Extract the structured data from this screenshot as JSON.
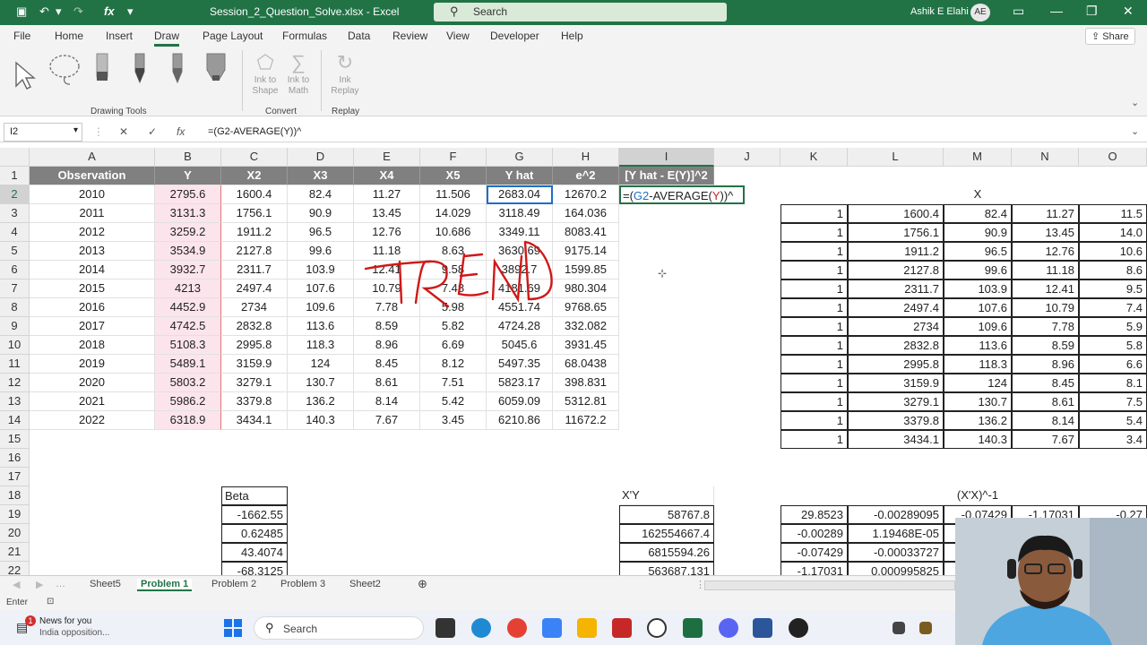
{
  "titlebar": {
    "title": "Session_2_Question_Solve.xlsx - Excel",
    "search_placeholder": "Search",
    "user_name": "Ashik E Elahi",
    "user_initials": "AE"
  },
  "menu": [
    "File",
    "Home",
    "Insert",
    "Draw",
    "Page Layout",
    "Formulas",
    "Data",
    "Review",
    "View",
    "Developer",
    "Help"
  ],
  "share_label": "Share",
  "ribbon": {
    "drawing_tools": "Drawing Tools",
    "ink_to_shape": "Ink to Shape",
    "ink_to_math": "Ink to Math",
    "convert": "Convert",
    "ink_replay": "Ink Replay",
    "replay": "Replay"
  },
  "formula_bar": {
    "name_box": "I2",
    "formula": "=(G2-AVERAGE(Y))^"
  },
  "columns": [
    "A",
    "B",
    "C",
    "D",
    "E",
    "F",
    "G",
    "H",
    "I",
    "J",
    "K",
    "L",
    "M",
    "N",
    "O"
  ],
  "rows": [
    "1",
    "2",
    "3",
    "4",
    "5",
    "6",
    "7",
    "8",
    "9",
    "10",
    "11",
    "12",
    "13",
    "14",
    "15",
    "16",
    "17",
    "18",
    "19",
    "20",
    "21",
    "22"
  ],
  "header_row": [
    "Observation",
    "Y",
    "X2",
    "X3",
    "X4",
    "X5",
    "Y hat",
    "e^2",
    "[Y hat - E(Y)]^2"
  ],
  "table": [
    [
      "2010",
      "2795.6",
      "1600.4",
      "82.4",
      "11.27",
      "11.506",
      "2683.04",
      "12670.2"
    ],
    [
      "2011",
      "3131.3",
      "1756.1",
      "90.9",
      "13.45",
      "14.029",
      "3118.49",
      "164.036"
    ],
    [
      "2012",
      "3259.2",
      "1911.2",
      "96.5",
      "12.76",
      "10.686",
      "3349.11",
      "8083.41"
    ],
    [
      "2013",
      "3534.9",
      "2127.8",
      "99.6",
      "11.18",
      "8.63",
      "3630.69",
      "9175.14"
    ],
    [
      "2014",
      "3932.7",
      "2311.7",
      "103.9",
      "12.41",
      "9.58",
      "3892.7",
      "1599.85"
    ],
    [
      "2015",
      "4213",
      "2497.4",
      "107.6",
      "10.79",
      "7.48",
      "4181.69",
      "980.304"
    ],
    [
      "2016",
      "4452.9",
      "2734",
      "109.6",
      "7.78",
      "5.98",
      "4551.74",
      "9768.65"
    ],
    [
      "2017",
      "4742.5",
      "2832.8",
      "113.6",
      "8.59",
      "5.82",
      "4724.28",
      "332.082"
    ],
    [
      "2018",
      "5108.3",
      "2995.8",
      "118.3",
      "8.96",
      "6.69",
      "5045.6",
      "3931.45"
    ],
    [
      "2019",
      "5489.1",
      "3159.9",
      "124",
      "8.45",
      "8.12",
      "5497.35",
      "68.0438"
    ],
    [
      "2020",
      "5803.2",
      "3279.1",
      "130.7",
      "8.61",
      "7.51",
      "5823.17",
      "398.831"
    ],
    [
      "2021",
      "5986.2",
      "3379.8",
      "136.2",
      "8.14",
      "5.42",
      "6059.09",
      "5312.81"
    ],
    [
      "2022",
      "6318.9",
      "3434.1",
      "140.3",
      "7.67",
      "3.45",
      "6210.86",
      "11672.2"
    ]
  ],
  "editing_cell": {
    "prefix": "=(",
    "ref1": "G2",
    "mid": "-AVERAGE(",
    "ref2": "Y",
    "suffix": "))^"
  },
  "x_label": "X",
  "x_matrix": [
    [
      "1",
      "1600.4",
      "82.4",
      "11.27",
      "11.5"
    ],
    [
      "1",
      "1756.1",
      "90.9",
      "13.45",
      "14.0"
    ],
    [
      "1",
      "1911.2",
      "96.5",
      "12.76",
      "10.6"
    ],
    [
      "1",
      "2127.8",
      "99.6",
      "11.18",
      "8.6"
    ],
    [
      "1",
      "2311.7",
      "103.9",
      "12.41",
      "9.5"
    ],
    [
      "1",
      "2497.4",
      "107.6",
      "10.79",
      "7.4"
    ],
    [
      "1",
      "2734",
      "109.6",
      "7.78",
      "5.9"
    ],
    [
      "1",
      "2832.8",
      "113.6",
      "8.59",
      "5.8"
    ],
    [
      "1",
      "2995.8",
      "118.3",
      "8.96",
      "6.6"
    ],
    [
      "1",
      "3159.9",
      "124",
      "8.45",
      "8.1"
    ],
    [
      "1",
      "3279.1",
      "130.7",
      "8.61",
      "7.5"
    ],
    [
      "1",
      "3379.8",
      "136.2",
      "8.14",
      "5.4"
    ],
    [
      "1",
      "3434.1",
      "140.3",
      "7.67",
      "3.4"
    ]
  ],
  "beta_label": "Beta",
  "beta": [
    "-1662.55",
    "0.62485",
    "43.4074",
    "-68.3125"
  ],
  "xty_label": "X'Y",
  "xty": [
    "58767.8",
    "162554667.4",
    "6815594.26",
    "563687.131"
  ],
  "xtx_inv_label": "(X'X)^-1",
  "xtx_inv": [
    [
      "29.8523",
      "-0.00289095",
      "-0.07429",
      "-1.17031",
      "-0.27"
    ],
    [
      "-0.00289",
      "1.19468E-05",
      "",
      ""
    ],
    [
      "-0.07429",
      "-0.00033727",
      "",
      ""
    ],
    [
      "-1.17031",
      "0.000995825",
      "",
      ""
    ]
  ],
  "handwriting": "TREND",
  "sheet_tabs": [
    "Sheet5",
    "Problem 1",
    "Problem 2",
    "Problem 3",
    "Sheet2"
  ],
  "status": "Enter",
  "taskbar": {
    "news_title": "News for you",
    "news_sub": "India opposition...",
    "news_badge": "1",
    "search": "Search"
  }
}
